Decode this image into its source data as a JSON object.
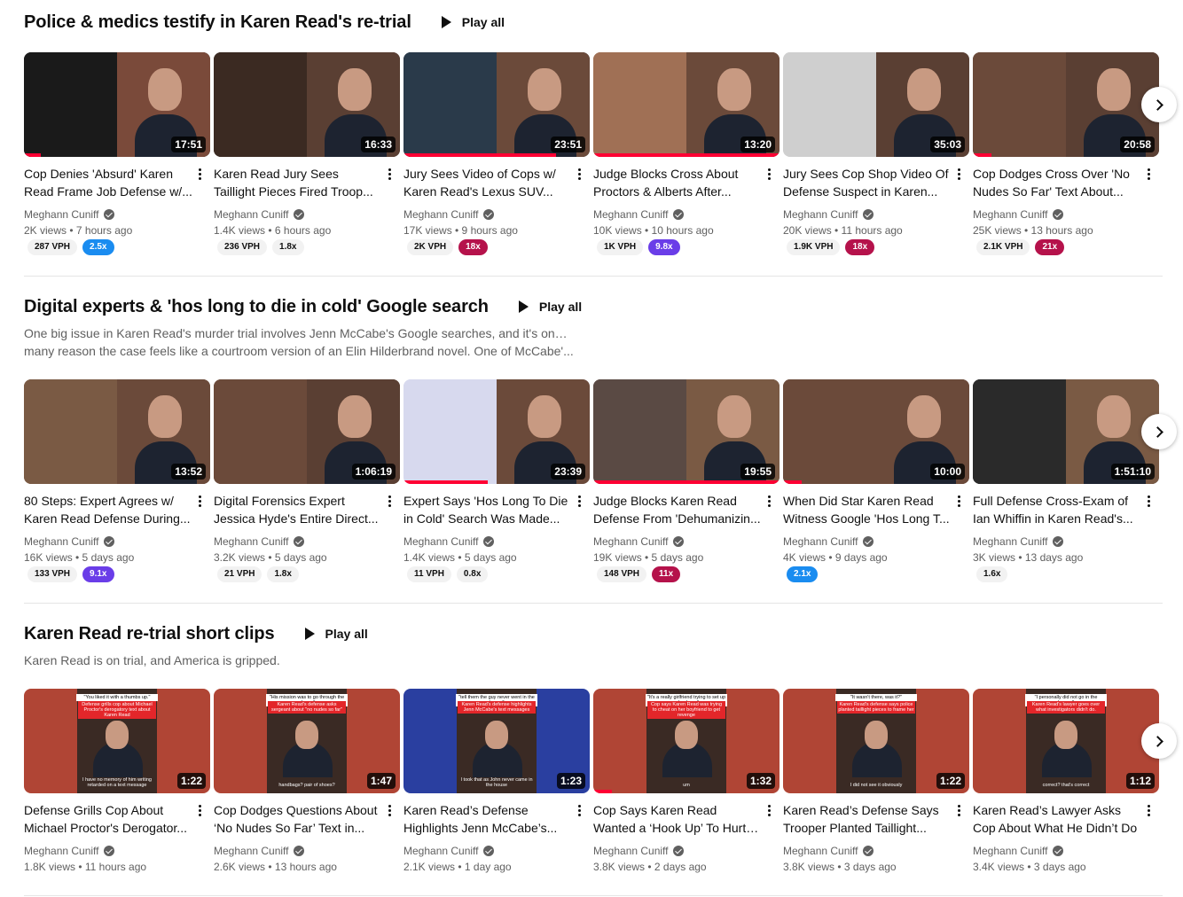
{
  "shelves": [
    {
      "title": "Police & medics testify in Karen Read's re-trial",
      "play_all": "Play all",
      "description": [],
      "videos": [
        {
          "title": "Cop Denies 'Absurd' Karen Read Frame Job Defense w/...",
          "duration": "17:51",
          "channel": "Meghann Cuniff",
          "stats": "2K views • 7 hours ago",
          "vph": "287 VPH",
          "mult": "2.5x",
          "mult_color": "blue",
          "progress": 0.09
        },
        {
          "title": "Karen Read Jury Sees Taillight Pieces Fired Troop...",
          "duration": "16:33",
          "channel": "Meghann Cuniff",
          "stats": "1.4K views • 6 hours ago",
          "vph": "236 VPH",
          "mult": "1.8x",
          "mult_color": "gray",
          "progress": 0
        },
        {
          "title": "Jury Sees Video of Cops w/ Karen Read's Lexus SUV...",
          "duration": "23:51",
          "channel": "Meghann Cuniff",
          "stats": "17K views • 9 hours ago",
          "vph": "2K VPH",
          "mult": "18x",
          "mult_color": "crimson",
          "progress": 0.82
        },
        {
          "title": "Judge Blocks Cross About Proctors & Alberts After...",
          "duration": "13:20",
          "channel": "Meghann Cuniff",
          "stats": "10K views • 10 hours ago",
          "vph": "1K VPH",
          "mult": "9.8x",
          "mult_color": "purple",
          "progress": 1.0
        },
        {
          "title": "Jury Sees Cop Shop Video Of Defense Suspect in Karen...",
          "duration": "35:03",
          "channel": "Meghann Cuniff",
          "stats": "20K views • 11 hours ago",
          "vph": "1.9K VPH",
          "mult": "18x",
          "mult_color": "crimson",
          "progress": 0
        },
        {
          "title": "Cop Dodges Cross Over 'No Nudes So Far' Text About...",
          "duration": "20:58",
          "channel": "Meghann Cuniff",
          "stats": "25K views • 13 hours ago",
          "vph": "2.1K VPH",
          "mult": "21x",
          "mult_color": "crimson",
          "progress": 0.1
        }
      ]
    },
    {
      "title": "Digital experts & 'hos long to die in cold' Google search",
      "play_all": "Play all",
      "description": [
        "One big issue in Karen Read's murder trial involves Jenn McCabe's Google searches, and it's one of",
        "many reason the case feels like a courtroom version of an Elin Hilderbrand novel. One of McCabe'..."
      ],
      "videos": [
        {
          "title": "80 Steps: Expert Agrees w/ Karen Read Defense During...",
          "duration": "13:52",
          "channel": "Meghann Cuniff",
          "stats": "16K views • 5 days ago",
          "vph": "133 VPH",
          "mult": "9.1x",
          "mult_color": "purple",
          "progress": 0
        },
        {
          "title": "Digital Forensics Expert Jessica Hyde's Entire Direct...",
          "duration": "1:06:19",
          "channel": "Meghann Cuniff",
          "stats": "3.2K views • 5 days ago",
          "vph": "21 VPH",
          "mult": "1.8x",
          "mult_color": "gray",
          "progress": 0
        },
        {
          "title": "Expert Says 'Hos Long To Die in Cold' Search Was Made...",
          "duration": "23:39",
          "channel": "Meghann Cuniff",
          "stats": "1.4K views • 5 days ago",
          "vph": "11 VPH",
          "mult": "0.8x",
          "mult_color": "gray",
          "progress": 0.45
        },
        {
          "title": "Judge Blocks Karen Read Defense From 'Dehumanizin...",
          "duration": "19:55",
          "channel": "Meghann Cuniff",
          "stats": "19K views • 5 days ago",
          "vph": "148 VPH",
          "mult": "11x",
          "mult_color": "crimson",
          "progress": 1.0
        },
        {
          "title": "When Did Star Karen Read Witness Google 'Hos Long T...",
          "duration": "10:00",
          "channel": "Meghann Cuniff",
          "stats": "4K views • 9 days ago",
          "vph": "",
          "mult": "2.1x",
          "mult_color": "blue",
          "progress": 0.1
        },
        {
          "title": "Full Defense Cross-Exam of Ian Whiffin in Karen Read's...",
          "duration": "1:51:10",
          "channel": "Meghann Cuniff",
          "stats": "3K views • 13 days ago",
          "vph": "",
          "mult": "1.6x",
          "mult_color": "gray",
          "progress": 0
        }
      ]
    },
    {
      "title": "Karen Read re-trial short clips",
      "play_all": "Play all",
      "description": [
        "Karen Read is on trial, and America is gripped."
      ],
      "videos": [
        {
          "title": "Defense Grills Cop About Michael Proctor's Derogator...",
          "duration": "1:22",
          "channel": "Meghann Cuniff",
          "stats": "1.8K views • 11 hours ago",
          "top": "\"You liked it with a thumbs up.\"",
          "sub": "Defense grills cop about Michael Proctor's derogatory text about Karen Read",
          "cap": "I have no memory of him writing retarded on a text message",
          "progress": 0
        },
        {
          "title": "Cop Dodges Questions About ‘No Nudes So Far’ Text in...",
          "duration": "1:47",
          "channel": "Meghann Cuniff",
          "stats": "2.6K views • 13 hours ago",
          "top": "\"His mission was to go through the phone.\"",
          "sub": "Karen Read's defense asks sergeant about \"no nudes so far\"",
          "cap": "handbags? pair of shoes?",
          "progress": 0
        },
        {
          "title": "Karen Read’s Defense Highlights Jenn McCabe’s...",
          "duration": "1:23",
          "channel": "Meghann Cuniff",
          "stats": "2.1K views • 1 day ago",
          "top": "\"tell them the guy never went in the house\"",
          "sub": "Karen Read's defense highlights Jenn McCabe's text messages",
          "cap": "I took that as John never came in the house",
          "progress": 0
        },
        {
          "title": "Cop Says Karen Read Wanted a ‘Hook Up’ To Hurt Boyfriend",
          "duration": "1:32",
          "channel": "Meghann Cuniff",
          "stats": "3.8K views • 2 days ago",
          "top": "\"It's a really girlfriend trying to set up a hook up.\"",
          "sub": "Cop says Karen Read was trying to cheat on her boyfriend to get revenge",
          "cap": "um",
          "progress": 0.1
        },
        {
          "title": "Karen Read’s Defense Says Trooper Planted Taillight...",
          "duration": "1:22",
          "channel": "Meghann Cuniff",
          "stats": "3.8K views • 3 days ago",
          "top": "\"It wasn't there, was it?\"",
          "sub": "Karen Read's defense says police planted taillight pieces to frame her",
          "cap": "I did not see it obviously",
          "progress": 0
        },
        {
          "title": "Karen Read’s Lawyer Asks Cop About What He Didn’t Do",
          "duration": "1:12",
          "channel": "Meghann Cuniff",
          "stats": "3.4K views • 3 days ago",
          "top": "\"I personally did not go in the house.\"",
          "sub": "Karen Read's lawyer goes over what investigators didn't do.",
          "cap": "correct? that's correct",
          "progress": 0
        }
      ]
    }
  ],
  "colors": {
    "blue": "#1a8cf0",
    "purple": "#6a3de8",
    "crimson": "#b5124b",
    "progress": "#ff0033"
  },
  "icons": {
    "play": "play-icon",
    "next": "chevron-right-icon",
    "menu": "more-vert-icon",
    "verified": "verified-check-icon"
  }
}
